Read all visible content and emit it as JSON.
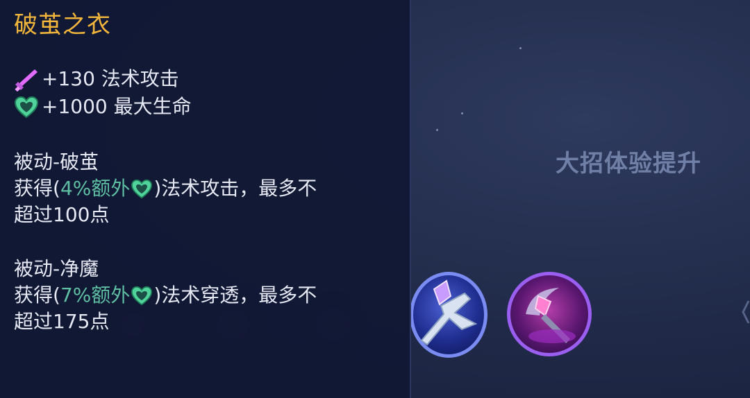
{
  "item": {
    "name": "破茧之衣",
    "stats": [
      {
        "icon": "magic-attack-icon",
        "text": "+130 法术攻击"
      },
      {
        "icon": "max-health-icon",
        "text": "+1000 最大生命"
      }
    ],
    "passives": [
      {
        "title": "被动-破茧",
        "prefix": "获得(",
        "highlight": "4%额外",
        "suffix": ")法术攻击，最多不",
        "line2": "超过100点"
      },
      {
        "title": "被动-净魔",
        "prefix": "获得(",
        "highlight": "7%额外",
        "suffix": ")法术穿透，最多不",
        "line2": "超过175点"
      }
    ]
  },
  "side_caption": "大招体验提升",
  "colors": {
    "title": "#f1b53b",
    "highlight": "#5fbfa3",
    "text": "#e6e9f3",
    "caption": "#6f7fa6"
  },
  "icons": [
    "magic-staff-item-icon",
    "crystal-scythe-item-icon"
  ]
}
